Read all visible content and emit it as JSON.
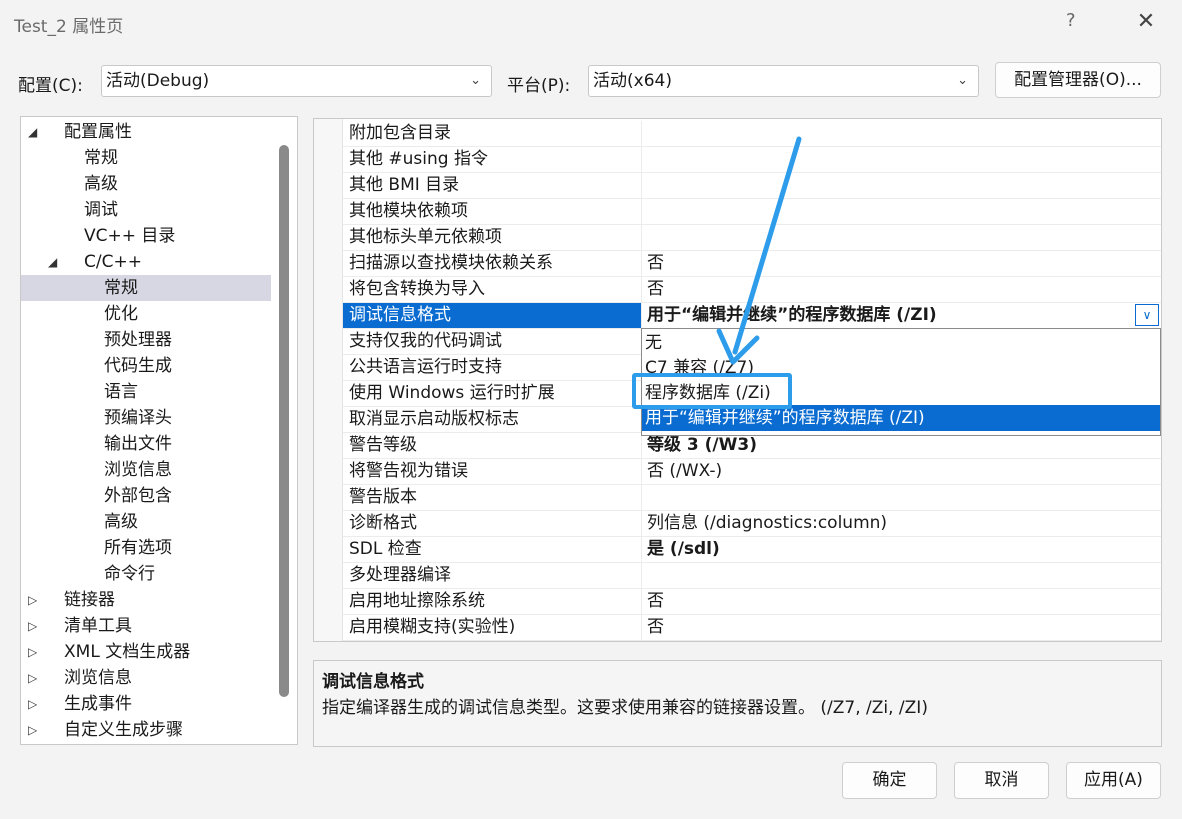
{
  "window": {
    "title": "Test_2 属性页",
    "help": "?",
    "close": "✕"
  },
  "config": {
    "label": "配置(C):",
    "value": "活动(Debug)"
  },
  "platform": {
    "label": "平台(P):",
    "value": "活动(x64)"
  },
  "config_manager_label": "配置管理器(O)...",
  "tree": {
    "items": [
      {
        "label": "配置属性",
        "twisty": "◢"
      },
      {
        "label": "常规"
      },
      {
        "label": "高级"
      },
      {
        "label": "调试"
      },
      {
        "label": "VC++ 目录"
      },
      {
        "label": "C/C++",
        "twisty": "◢"
      },
      {
        "label": "常规"
      },
      {
        "label": "优化"
      },
      {
        "label": "预处理器"
      },
      {
        "label": "代码生成"
      },
      {
        "label": "语言"
      },
      {
        "label": "预编译头"
      },
      {
        "label": "输出文件"
      },
      {
        "label": "浏览信息"
      },
      {
        "label": "外部包含"
      },
      {
        "label": "高级"
      },
      {
        "label": "所有选项"
      },
      {
        "label": "命令行"
      },
      {
        "label": "链接器",
        "twisty": "▷"
      },
      {
        "label": "清单工具",
        "twisty": "▷"
      },
      {
        "label": "XML 文档生成器",
        "twisty": "▷"
      },
      {
        "label": "浏览信息",
        "twisty": "▷"
      },
      {
        "label": "生成事件",
        "twisty": "▷"
      },
      {
        "label": "自定义生成步骤",
        "twisty": "▷"
      }
    ]
  },
  "grid": {
    "rows": [
      {
        "name": "附加包含目录",
        "value": ""
      },
      {
        "name": "其他 #using 指令",
        "value": ""
      },
      {
        "name": "其他 BMI 目录",
        "value": ""
      },
      {
        "name": "其他模块依赖项",
        "value": ""
      },
      {
        "name": "其他标头单元依赖项",
        "value": ""
      },
      {
        "name": "扫描源以查找模块依赖关系",
        "value": "否"
      },
      {
        "name": "将包含转换为导入",
        "value": "否"
      },
      {
        "name": "调试信息格式",
        "value": "用于“编辑并继续”的程序数据库 (/ZI)"
      },
      {
        "name": "支持仅我的代码调试",
        "value": ""
      },
      {
        "name": "公共语言运行时支持",
        "value": ""
      },
      {
        "name": "使用 Windows 运行时扩展",
        "value": ""
      },
      {
        "name": "取消显示启动版权标志",
        "value": ""
      },
      {
        "name": "警告等级",
        "value": "等级 3 (/W3)"
      },
      {
        "name": "将警告视为错误",
        "value": "否 (/WX-)"
      },
      {
        "name": "警告版本",
        "value": ""
      },
      {
        "name": "诊断格式",
        "value": "列信息 (/diagnostics:column)"
      },
      {
        "name": "SDL 检查",
        "value": "是 (/sdl)"
      },
      {
        "name": "多处理器编译",
        "value": ""
      },
      {
        "name": "启用地址擦除系统",
        "value": "否"
      },
      {
        "name": "启用模糊支持(实验性)",
        "value": "否"
      }
    ]
  },
  "dropdown": {
    "options": [
      "无",
      "C7 兼容 (/Z7)",
      "程序数据库 (/Zi)",
      "用于“编辑并继续”的程序数据库 (/ZI)"
    ]
  },
  "description": {
    "title": "调试信息格式",
    "text": "指定编译器生成的调试信息类型。这要求使用兼容的链接器设置。  (/Z7, /Zi, /ZI)"
  },
  "buttons": {
    "ok": "确定",
    "cancel": "取消",
    "apply": "应用(A)"
  },
  "colors": {
    "selection": "#0a6cd0",
    "highlight_box": "#2d9cea",
    "tree_selection": "#d7d7e3"
  }
}
